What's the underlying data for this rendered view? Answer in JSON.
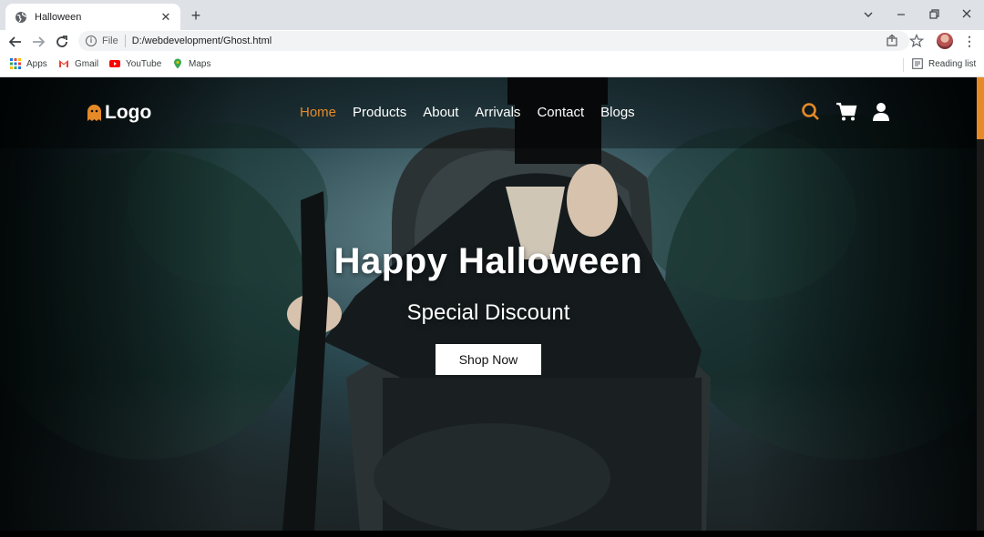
{
  "browser": {
    "tab_title": "Halloween",
    "new_tab_symbol": "+",
    "scheme": "File",
    "url": "D:/webdevelopment/Ghost.html",
    "bookmarks": [
      {
        "label": "Apps",
        "icon": "apps-grid-icon"
      },
      {
        "label": "Gmail",
        "icon": "gmail-icon"
      },
      {
        "label": "YouTube",
        "icon": "youtube-icon"
      },
      {
        "label": "Maps",
        "icon": "maps-icon"
      }
    ],
    "reading_list": "Reading list"
  },
  "site": {
    "logo": "Logo",
    "nav": [
      {
        "label": "Home",
        "active": true
      },
      {
        "label": "Products",
        "active": false
      },
      {
        "label": "About",
        "active": false
      },
      {
        "label": "Arrivals",
        "active": false
      },
      {
        "label": "Contact",
        "active": false
      },
      {
        "label": "Blogs",
        "active": false
      }
    ],
    "hero_title": "Happy Halloween",
    "hero_subtitle": "Special Discount",
    "cta": "Shop Now",
    "accent_color": "#e58a27"
  }
}
